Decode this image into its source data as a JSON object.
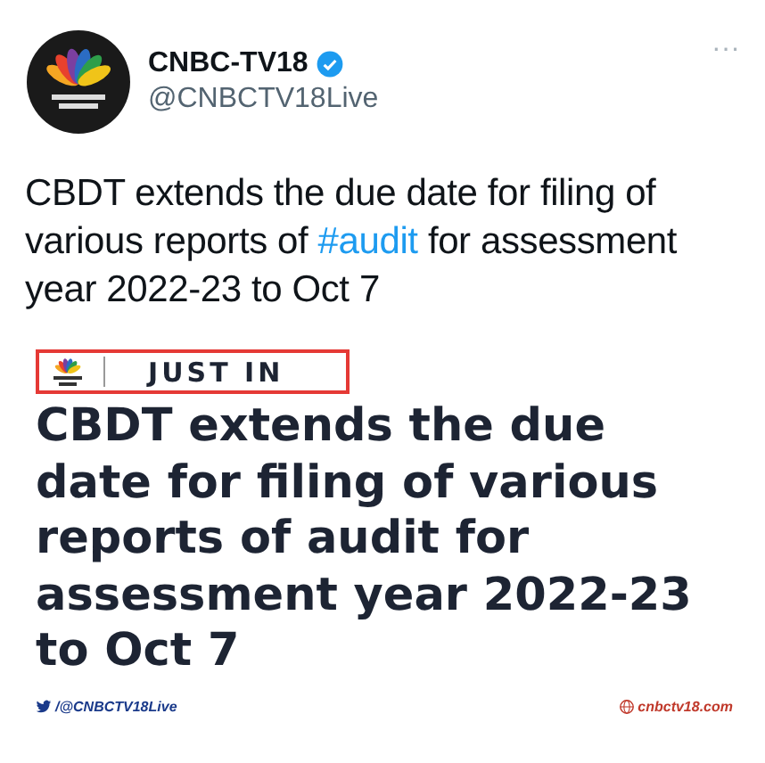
{
  "author": {
    "name": "CNBC-TV18",
    "verified": true,
    "handle": "@CNBCTV18Live"
  },
  "more": "···",
  "text": "CBDT extends the due date for filing of various reports of ",
  "hashtag": "#audit",
  "text_end": " for assessment year 2022-23 to Oct 7",
  "image": {
    "badge": "JUST IN",
    "headline": "CBDT extends the due date for filing of various reports of audit for assessment year 2022-23 to Oct 7",
    "footer_left": "/@CNBCTV18Live",
    "footer_right": "cnbctv18.com"
  }
}
